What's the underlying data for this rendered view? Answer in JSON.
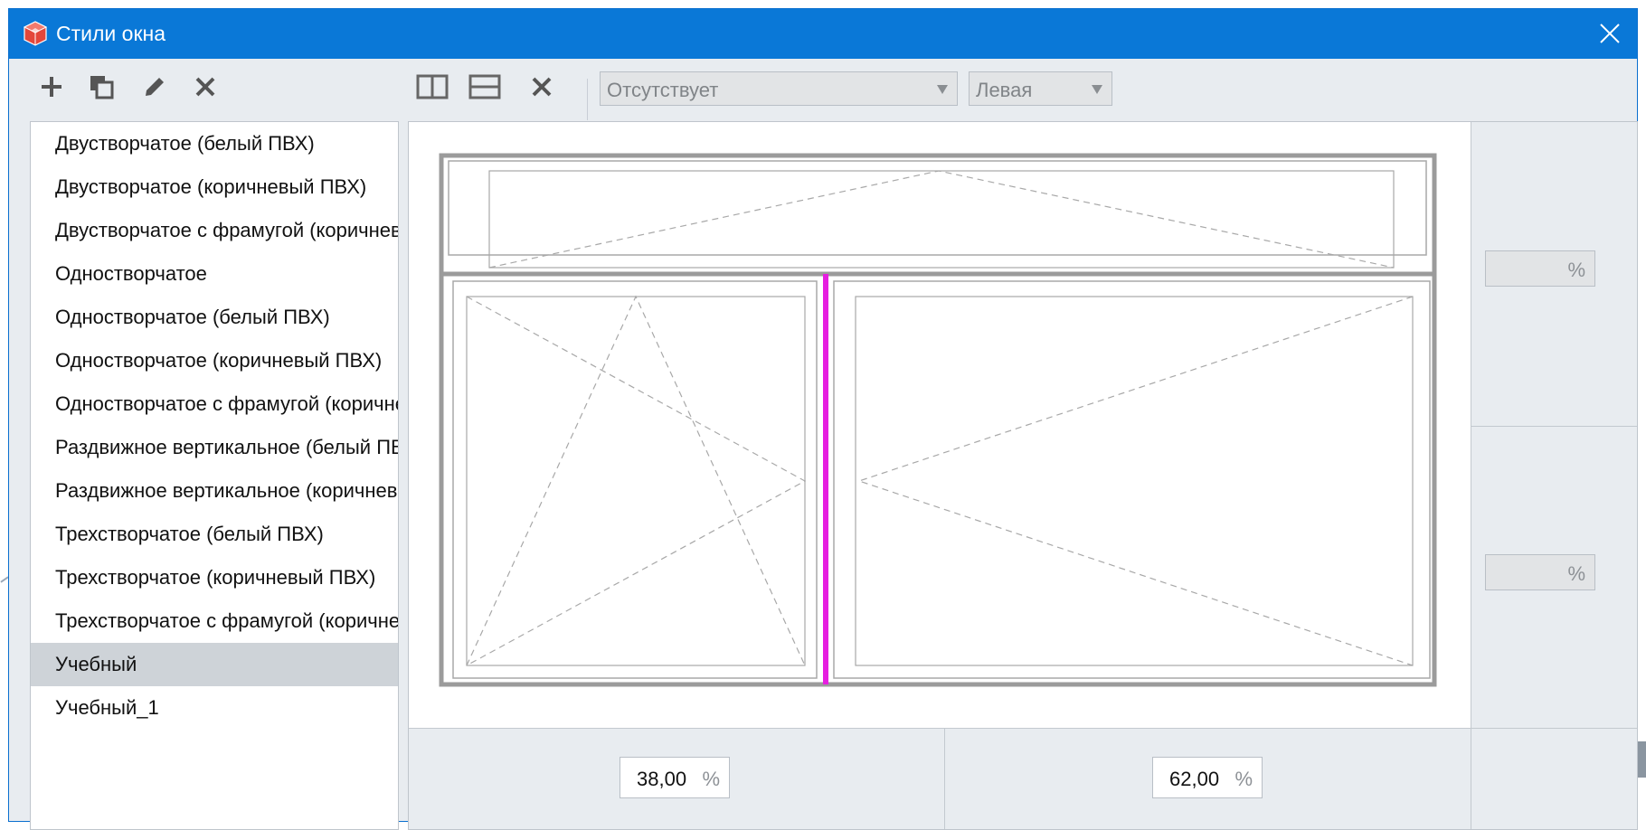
{
  "window": {
    "title": "Стили окна"
  },
  "toolbar": {
    "left_buttons": [
      "add-icon",
      "copy-icon",
      "edit-icon",
      "delete-icon"
    ],
    "right_buttons": [
      "split-vertical-icon",
      "split-horizontal-icon",
      "remove-split-icon"
    ],
    "opening_type": "Отсутствует",
    "opening_side": "Левая"
  },
  "styles_list": {
    "items": [
      "Двустворчатое (белый ПВХ)",
      "Двустворчатое (коричневый ПВХ)",
      "Двустворчатое с фрамугой (коричневый ПВХ)",
      "Одностворчатое",
      "Одностворчатое (белый ПВХ)",
      "Одностворчатое (коричневый ПВХ)",
      "Одностворчатое с фрамугой (коричневый ПВХ)",
      "Раздвижное вертикальное (белый ПВХ)",
      "Раздвижное вертикальное (коричневый ПВХ)",
      "Трехстворчатое (белый ПВХ)",
      "Трехстворчатое (коричневый ПВХ)",
      "Трехстворчатое с фрамугой (коричневый ПВХ)",
      "Учебный",
      "Учебный_1"
    ],
    "selected": "Учебный"
  },
  "proportions": {
    "row_top": {
      "value": "",
      "unit": "%"
    },
    "row_bottom": {
      "value": "",
      "unit": "%"
    },
    "col_left": {
      "value": "38,00",
      "unit": "%"
    },
    "col_right": {
      "value": "62,00",
      "unit": "%"
    }
  },
  "colors": {
    "titlebar": "#0A78D7",
    "selected_divider": "#E61EE0",
    "frame": "#9B9B9B",
    "selection": "#CED3D8"
  }
}
